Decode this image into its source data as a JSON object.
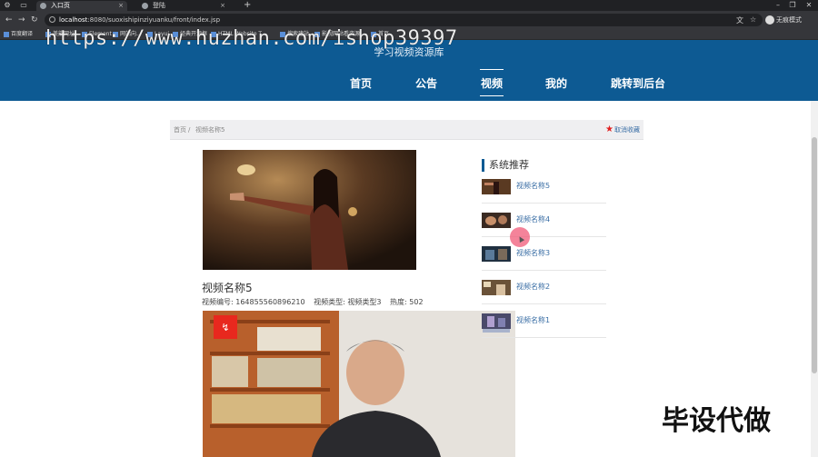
{
  "browser": {
    "tabs": [
      {
        "label": "入口页",
        "active": true
      },
      {
        "label": "登陆",
        "active": false
      }
    ],
    "url_host": "localhost",
    "url_rest": ":8080/suoxishipinziyuanku/front/index.jsp",
    "incognito_label": "无痕模式",
    "bookmarks": [
      "百度翻译",
      "美能网址",
      "Element",
      "网站向...",
      "Layui",
      "经典开源框",
      "HTML Website T...",
      "搜索建站",
      "影视网站看资源",
      "首页"
    ]
  },
  "watermark": "https://www.huzhan.com/ishop39397",
  "site": {
    "title": "学习视频资源库",
    "nav": [
      {
        "label": "首页",
        "active": false
      },
      {
        "label": "公告",
        "active": false
      },
      {
        "label": "视频",
        "active": true
      },
      {
        "label": "我的",
        "active": false
      },
      {
        "label": "跳转到后台",
        "active": false
      }
    ]
  },
  "breadcrumb": {
    "home": "首页",
    "separator": "/",
    "current": "视频名称5",
    "favorite_action": "取消收藏"
  },
  "video": {
    "title": "视频名称5",
    "number_label": "视频编号:",
    "number": "164855560896210",
    "type_label": "视频类型:",
    "type": "视频类型3",
    "heat_label": "热度:",
    "heat": "502"
  },
  "sidebar": {
    "heading": "系统推荐",
    "items": [
      {
        "label": "视频名称5"
      },
      {
        "label": "视频名称4"
      },
      {
        "label": "视频名称3"
      },
      {
        "label": "视频名称2"
      },
      {
        "label": "视频名称1"
      }
    ]
  },
  "overlay": "毕设代做",
  "colors": {
    "header": "#0d5a93",
    "link": "#3a6ea5",
    "star": "#e02020"
  }
}
